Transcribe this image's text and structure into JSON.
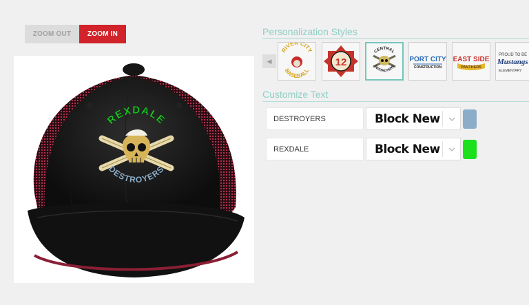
{
  "zoom": {
    "out_label": "ZOOM OUT",
    "in_label": "ZOOM IN"
  },
  "preview": {
    "logo": {
      "top_text": "REXDALE",
      "bottom_text": "DESTROYERS"
    }
  },
  "styles": {
    "title": "Personalization Styles",
    "scroll_left_icon": "chevron-left-icon",
    "items": [
      {
        "name": "river-city-baseball",
        "line1": "RIVER CITY",
        "line2": "BASEBALL"
      },
      {
        "name": "fire-12",
        "number": "12"
      },
      {
        "name": "central-destroyers",
        "line1": "CENTRAL",
        "line2": "DESTROYERS"
      },
      {
        "name": "port-city-construction",
        "line1": "PORT CITY",
        "line2": "CONSTRUCTION"
      },
      {
        "name": "east-side-panthers",
        "line1": "EAST SIDE",
        "line2": "PANTHERS"
      },
      {
        "name": "mustangs-elementary",
        "line1": "PROUD TO BE",
        "line2": "Mustangs",
        "line3": "ELEMENTARY"
      }
    ],
    "selected_index": 2
  },
  "customize": {
    "title": "Customize Text",
    "rows": [
      {
        "text": "DESTROYERS",
        "font": "Block New",
        "color": "#8badc9"
      },
      {
        "text": "REXDALE",
        "font": "Block New",
        "color": "#1de01d"
      }
    ]
  }
}
